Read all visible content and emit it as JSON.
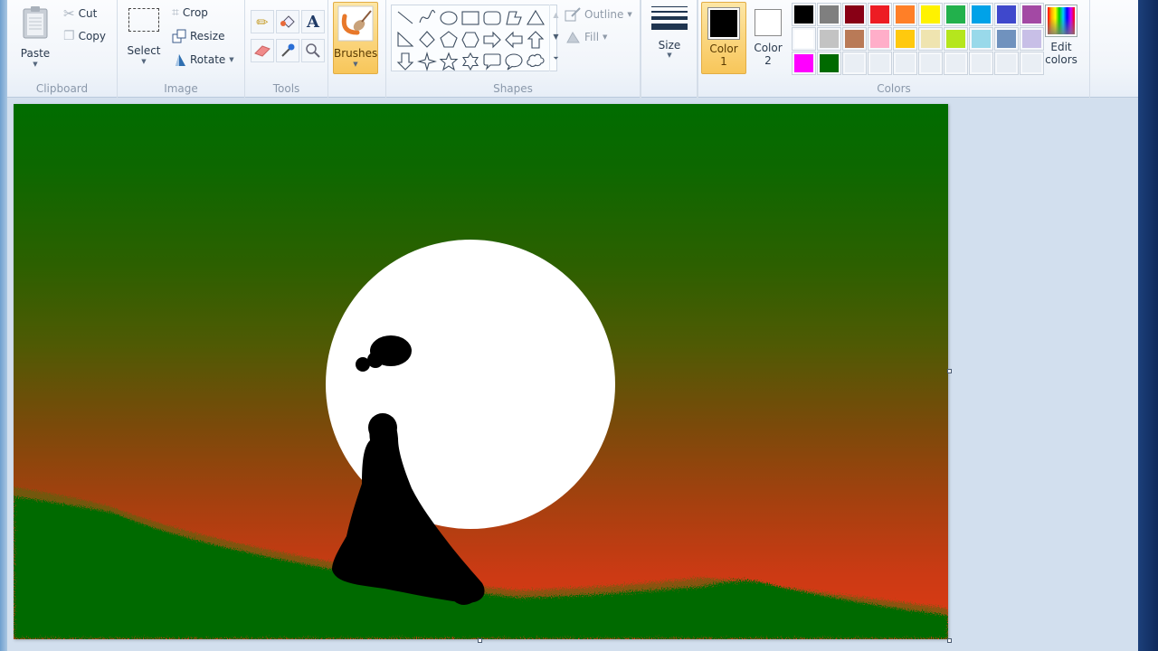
{
  "ribbon": {
    "clipboard": {
      "group_label": "Clipboard",
      "paste_label": "Paste",
      "cut_label": "Cut",
      "copy_label": "Copy"
    },
    "image": {
      "group_label": "Image",
      "select_label": "Select",
      "crop_label": "Crop",
      "resize_label": "Resize",
      "rotate_label": "Rotate"
    },
    "tools": {
      "group_label": "Tools",
      "items": [
        "pencil",
        "fill-with-color",
        "text",
        "eraser",
        "color-picker",
        "magnifier"
      ]
    },
    "brushes": {
      "label": "Brushes",
      "selected": true
    },
    "shapes": {
      "group_label": "Shapes",
      "items": [
        "line",
        "curve",
        "oval",
        "rectangle",
        "rounded-rectangle",
        "polygon",
        "triangle",
        "right-triangle",
        "diamond",
        "pentagon",
        "hexagon",
        "right-arrow",
        "left-arrow",
        "up-arrow",
        "down-arrow",
        "four-point-star",
        "five-point-star",
        "six-point-star",
        "rounded-callout",
        "oval-callout",
        "cloud-callout"
      ],
      "outline_label": "Outline",
      "fill_label": "Fill"
    },
    "size": {
      "label": "Size"
    },
    "colors": {
      "group_label": "Colors",
      "color1_label_line1": "Color",
      "color1_label_line2": "1",
      "color1_value": "#000000",
      "color2_label_line1": "Color",
      "color2_label_line2": "2",
      "color2_value": "#ffffff",
      "palette": [
        "#000000",
        "#7f7f7f",
        "#880015",
        "#ed1c24",
        "#ff7f27",
        "#fff200",
        "#22b14c",
        "#00a2e8",
        "#3f48cc",
        "#a349a4",
        "#ffffff",
        "#c3c3c3",
        "#b97a57",
        "#ffaec9",
        "#ffc90e",
        "#efe4b0",
        "#b5e61d",
        "#99d9ea",
        "#7092be",
        "#c8bfe7",
        "#ff00ff",
        "#006a00",
        "",
        "",
        "",
        "",
        "",
        "",
        "",
        ""
      ],
      "edit_colors_line1": "Edit",
      "edit_colors_line2": "colors"
    }
  },
  "canvas": {
    "description": "Sunset painting: green-to-red gradient sky, white sun, green hills, black silhouette"
  }
}
